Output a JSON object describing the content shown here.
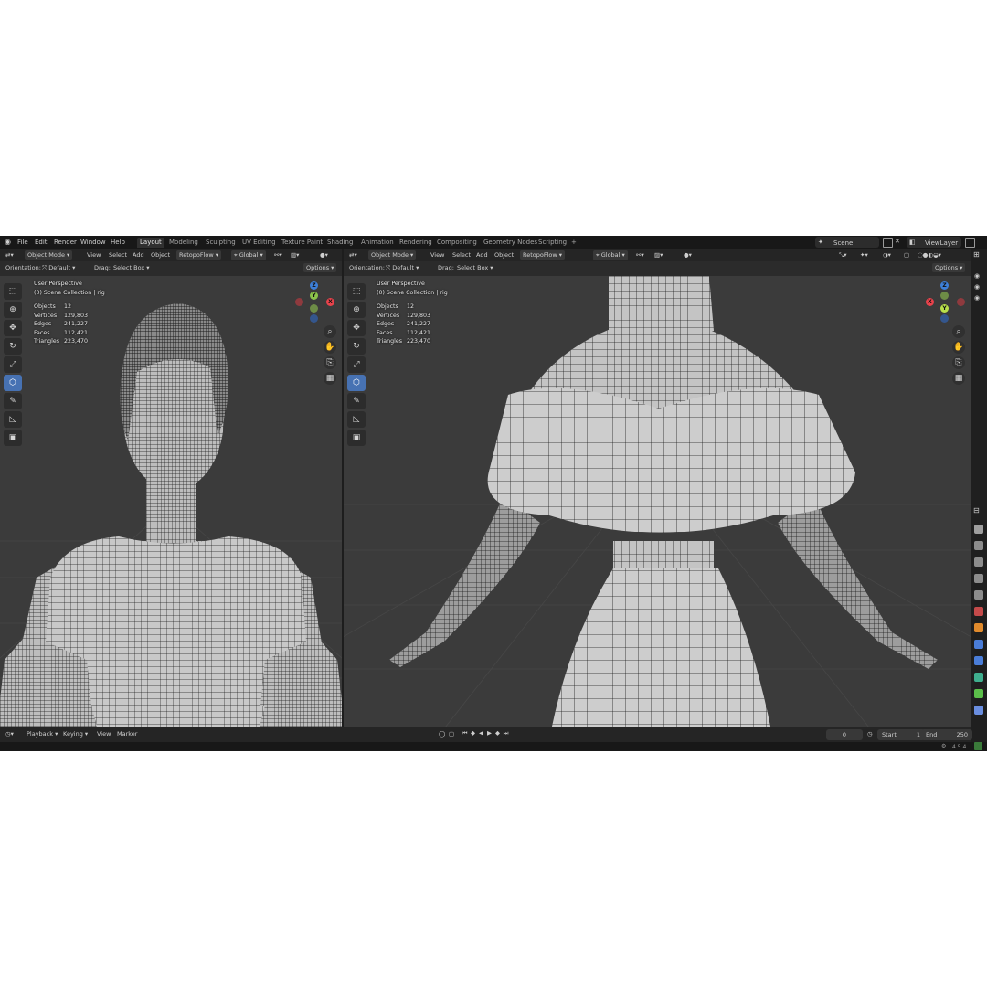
{
  "topbar": {
    "menus": [
      "File",
      "Edit",
      "Render",
      "Window",
      "Help"
    ],
    "workspaces": [
      "Layout",
      "Modeling",
      "Sculpting",
      "UV Editing",
      "Texture Paint",
      "Shading",
      "Animation",
      "Rendering",
      "Compositing",
      "Geometry Nodes",
      "Scripting"
    ],
    "add_tab": "+",
    "scene": "Scene",
    "view_layer": "ViewLayer"
  },
  "viewport_header": {
    "mode": "Object Mode",
    "menus": [
      "View",
      "Select",
      "Add",
      "Object"
    ],
    "addon": "RetopoFlow",
    "transform": "Global",
    "orientation_label": "Orientation:",
    "orientation_value": "Default",
    "drag_label": "Drag:",
    "drag_value": "Select Box",
    "options": "Options"
  },
  "viewport_left": {
    "perspective": "User Perspective",
    "collection": "(0) Scene Collection | rig",
    "stats": [
      {
        "label": "Objects",
        "value": "12"
      },
      {
        "label": "Vertices",
        "value": "129,803"
      },
      {
        "label": "Edges",
        "value": "241,227"
      },
      {
        "label": "Faces",
        "value": "112,421"
      },
      {
        "label": "Triangles",
        "value": "223,470"
      }
    ]
  },
  "viewport_right": {
    "perspective": "User Perspective",
    "collection": "(0) Scene Collection | rig",
    "stats": [
      {
        "label": "Objects",
        "value": "12"
      },
      {
        "label": "Vertices",
        "value": "129,803"
      },
      {
        "label": "Edges",
        "value": "241,227"
      },
      {
        "label": "Faces",
        "value": "112,421"
      },
      {
        "label": "Triangles",
        "value": "223,470"
      }
    ]
  },
  "gizmo": {
    "x": "X",
    "y": "Y",
    "z": "Z"
  },
  "timeline": {
    "menus": [
      "Playback",
      "Keying",
      "View",
      "Marker"
    ],
    "current_frame": "0",
    "start_label": "Start",
    "start": "1",
    "end_label": "End",
    "end": "250"
  },
  "statusbar": {
    "version": "4.5.4"
  },
  "icons": {
    "tools": [
      "select-box-icon",
      "cursor-icon",
      "move-icon",
      "rotate-icon",
      "scale-icon",
      "transform-icon",
      "annotate-icon",
      "measure-icon",
      "add-cube-icon"
    ],
    "nav": [
      "zoom-icon",
      "pan-icon",
      "camera-view-icon",
      "perspective-grid-icon"
    ]
  },
  "colors": {
    "accent": "#4772b3",
    "axis_x": "#e8424b",
    "axis_y": "#8bc34a",
    "axis_z": "#3d7fd8",
    "mesh": "#bdbdbd",
    "wire": "#1a1a1a",
    "viewport_bg": "#3a3a3a"
  }
}
